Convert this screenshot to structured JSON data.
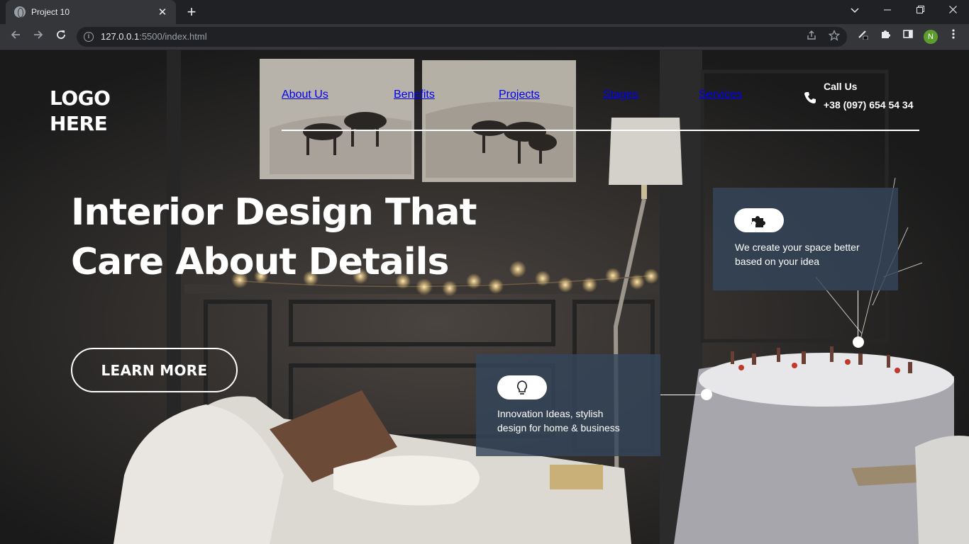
{
  "browser": {
    "tab_title": "Project 10",
    "tab_close": "✕",
    "new_tab": "+",
    "url_host": "127.0.0.1",
    "url_rest": ":5500/index.html",
    "profile_initial": "N"
  },
  "header": {
    "logo_line1": "LOGO",
    "logo_line2": "HERE",
    "nav": [
      "About Us",
      "Benefits",
      "Projects",
      "Stages",
      "Services"
    ],
    "call_label": "Call Us",
    "call_number": "+38 (097) 654 54 34"
  },
  "hero": {
    "title_line1": "Interior Design That",
    "title_line2": "Care About Details",
    "cta": "LEARN MORE"
  },
  "cards": {
    "space": {
      "icon": "puzzle-icon",
      "text_line1": "We create your space better",
      "text_line2": "based on your idea"
    },
    "ideas": {
      "icon": "lightbulb-icon",
      "text_line1": "Innovation Ideas, stylish",
      "text_line2": "design for home & business"
    }
  },
  "colors": {
    "card_bg": "#34465a",
    "text": "#ffffff"
  }
}
